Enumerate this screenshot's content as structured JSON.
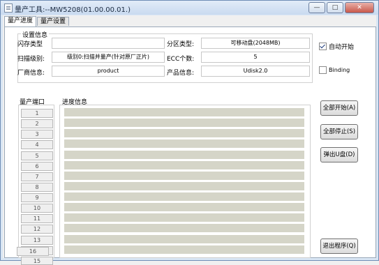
{
  "window": {
    "title": "量产工具:--MW5208(01.00.00.01.)"
  },
  "tabs": [
    {
      "label": "量产进度"
    },
    {
      "label": "量产设置"
    }
  ],
  "settings": {
    "group_title": "设置信息",
    "flash_type": {
      "label": "闪存类型",
      "value": ""
    },
    "scan_level": {
      "label": "扫描级别:",
      "value": "级别0:扫描并量产(针对原厂正片)"
    },
    "vendor": {
      "label": "厂商信息:",
      "value": "product"
    },
    "partition": {
      "label": "分区类型:",
      "value": "可移动盘(2048MB)"
    },
    "ecc": {
      "label": "ECC个数:",
      "value": "5"
    },
    "product": {
      "label": "产品信息:",
      "value": "Udisk2.0"
    }
  },
  "options": {
    "auto_start": {
      "label": "自动开始",
      "checked": true
    },
    "binding": {
      "label": "Binding",
      "checked": false
    }
  },
  "ports_title": "量产端口",
  "progress_title": "进度信息",
  "ports": [
    "1",
    "2",
    "3",
    "4",
    "5",
    "6",
    "7",
    "8",
    "9",
    "10",
    "11",
    "12",
    "13",
    "14",
    "15",
    "16"
  ],
  "buttons": {
    "start_all": "全部开始(A)",
    "stop_all": "全部停止(S)",
    "eject": "弹出U盘(D)",
    "exit": "退出程序(Q)"
  }
}
